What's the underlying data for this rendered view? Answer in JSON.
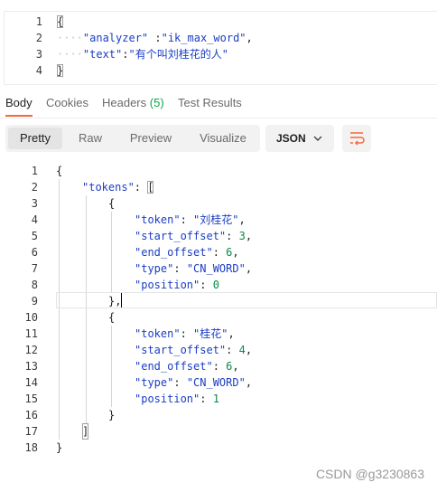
{
  "request_body": {
    "line_numbers": [
      "1",
      "2",
      "3",
      "4"
    ],
    "open_brace": "{",
    "close_brace": "}",
    "dots": "····",
    "analyzer_key": "\"analyzer\"",
    "analyzer_sep": " :",
    "analyzer_value": "\"ik_max_word\"",
    "analyzer_comma": ",",
    "text_key": "\"text\"",
    "text_sep": ":",
    "text_value": "\"有个叫刘桂花的人\""
  },
  "tabs": [
    {
      "label": "Body"
    },
    {
      "label": "Cookies"
    },
    {
      "label": "Headers",
      "count": "(5)"
    },
    {
      "label": "Test Results"
    }
  ],
  "view_modes": [
    "Pretty",
    "Raw",
    "Preview",
    "Visualize"
  ],
  "format": {
    "selected": "JSON"
  },
  "response": {
    "line_numbers": [
      "1",
      "2",
      "3",
      "4",
      "5",
      "6",
      "7",
      "8",
      "9",
      "10",
      "11",
      "12",
      "13",
      "14",
      "15",
      "16",
      "17",
      "18"
    ],
    "l1": "{",
    "tokens_key": "\"tokens\"",
    "colon": ": ",
    "open_bracket": "[",
    "l3": "{",
    "tok1": {
      "token": "\"刘桂花\"",
      "start_offset": "3",
      "end_offset": "6",
      "type": "\"CN_WORD\"",
      "position": "0"
    },
    "l9": "},",
    "l10": "{",
    "tok2": {
      "token": "\"桂花\"",
      "start_offset": "4",
      "end_offset": "6",
      "type": "\"CN_WORD\"",
      "position": "1"
    },
    "l16": "}",
    "close_bracket": "]",
    "l18": "}",
    "keys": {
      "token": "\"token\"",
      "start_offset": "\"start_offset\"",
      "end_offset": "\"end_offset\"",
      "type": "\"type\"",
      "position": "\"position\""
    },
    "comma": ","
  },
  "watermark": "CSDN @g3230863",
  "colors": {
    "accent": "#f26b3a",
    "key": "#1b3ec4",
    "number": "#0a8a4a",
    "badge": "#0aa84a"
  }
}
